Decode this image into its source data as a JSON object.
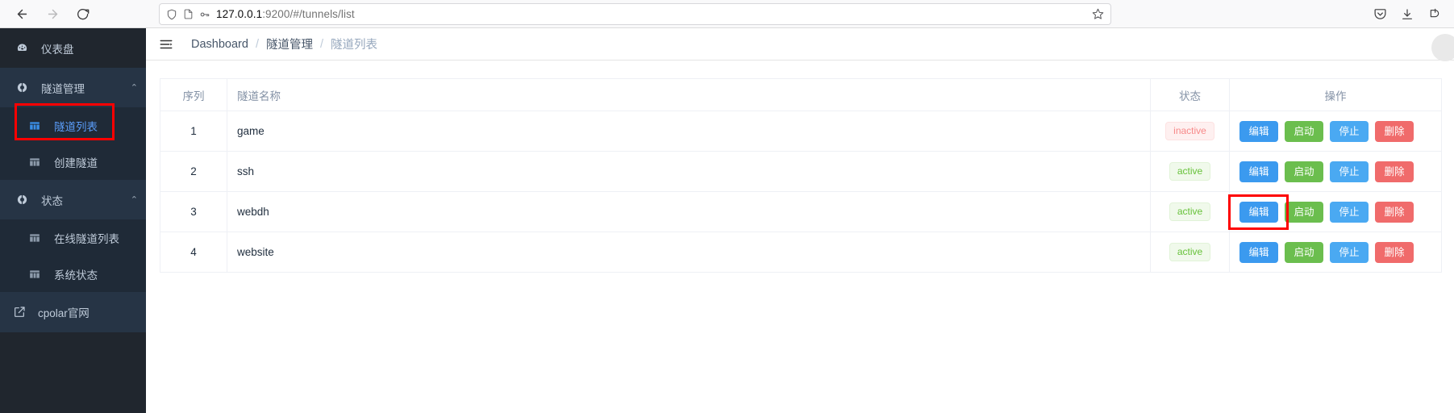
{
  "browser": {
    "back_label": "Back",
    "forward_label": "Forward",
    "reload_label": "Reload",
    "url_host": "127.0.0.1",
    "url_rest": ":9200/#/tunnels/list",
    "shield_icon": "shield-icon",
    "page_icon": "page-icon",
    "key_icon": "key-icon",
    "bookmark_icon": "star-icon",
    "pocket_icon": "pocket-icon",
    "downloads_icon": "download-icon",
    "extension_icon": "extension-icon"
  },
  "sidebar": {
    "items": [
      {
        "label": "仪表盘",
        "icon": "dashboard-icon",
        "type": "item"
      },
      {
        "label": "隧道管理",
        "icon": "tunnel-icon",
        "type": "group",
        "chevron": "⌃"
      },
      {
        "label": "隧道列表",
        "icon": "grid-icon",
        "type": "sub",
        "active": true
      },
      {
        "label": "创建隧道",
        "icon": "grid-icon",
        "type": "sub",
        "active": false
      },
      {
        "label": "状态",
        "icon": "tunnel-icon",
        "type": "group",
        "chevron": "⌃"
      },
      {
        "label": "在线隧道列表",
        "icon": "grid-icon",
        "type": "sub",
        "active": false
      },
      {
        "label": "系统状态",
        "icon": "grid-icon",
        "type": "sub",
        "active": false
      },
      {
        "label": "cpolar官网",
        "icon": "external-link-icon",
        "type": "external"
      }
    ]
  },
  "topbar": {
    "menu_toggle_icon": "hamburger-icon",
    "breadcrumb": [
      {
        "label": "Dashboard",
        "current": false
      },
      {
        "label": "隧道管理",
        "current": false
      },
      {
        "label": "隧道列表",
        "current": true
      }
    ],
    "separator": "/",
    "avatar_icon": "avatar-icon"
  },
  "table": {
    "headers": [
      "序列",
      "隧道名称",
      "状态",
      "操作"
    ],
    "rows": [
      {
        "seq": "1",
        "name": "game",
        "status": "inactive",
        "status_kind": "inactive"
      },
      {
        "seq": "2",
        "name": "ssh",
        "status": "active",
        "status_kind": "active"
      },
      {
        "seq": "3",
        "name": "webdh",
        "status": "active",
        "status_kind": "active"
      },
      {
        "seq": "4",
        "name": "website",
        "status": "active",
        "status_kind": "active"
      }
    ],
    "actions": [
      {
        "label": "编辑",
        "kind": "primary"
      },
      {
        "label": "启动",
        "kind": "success"
      },
      {
        "label": "停止",
        "kind": "info"
      },
      {
        "label": "删除",
        "kind": "danger"
      }
    ]
  },
  "colors": {
    "sidebar_bg": "#20262e",
    "sidebar_group_bg": "#263445",
    "accent_blue": "#3b9aef",
    "success_green": "#6bbe4e",
    "info_blue": "#4aa9f2",
    "danger_red": "#f06b6b",
    "badge_active_text": "#67c23a",
    "badge_inactive_text": "#f78989",
    "highlight_red": "#ff0000"
  },
  "highlights": [
    {
      "target": "sidebar-item-tunnel-list",
      "color": "#ff0000"
    },
    {
      "target": "row-3-edit-button",
      "color": "#fe0000"
    }
  ]
}
